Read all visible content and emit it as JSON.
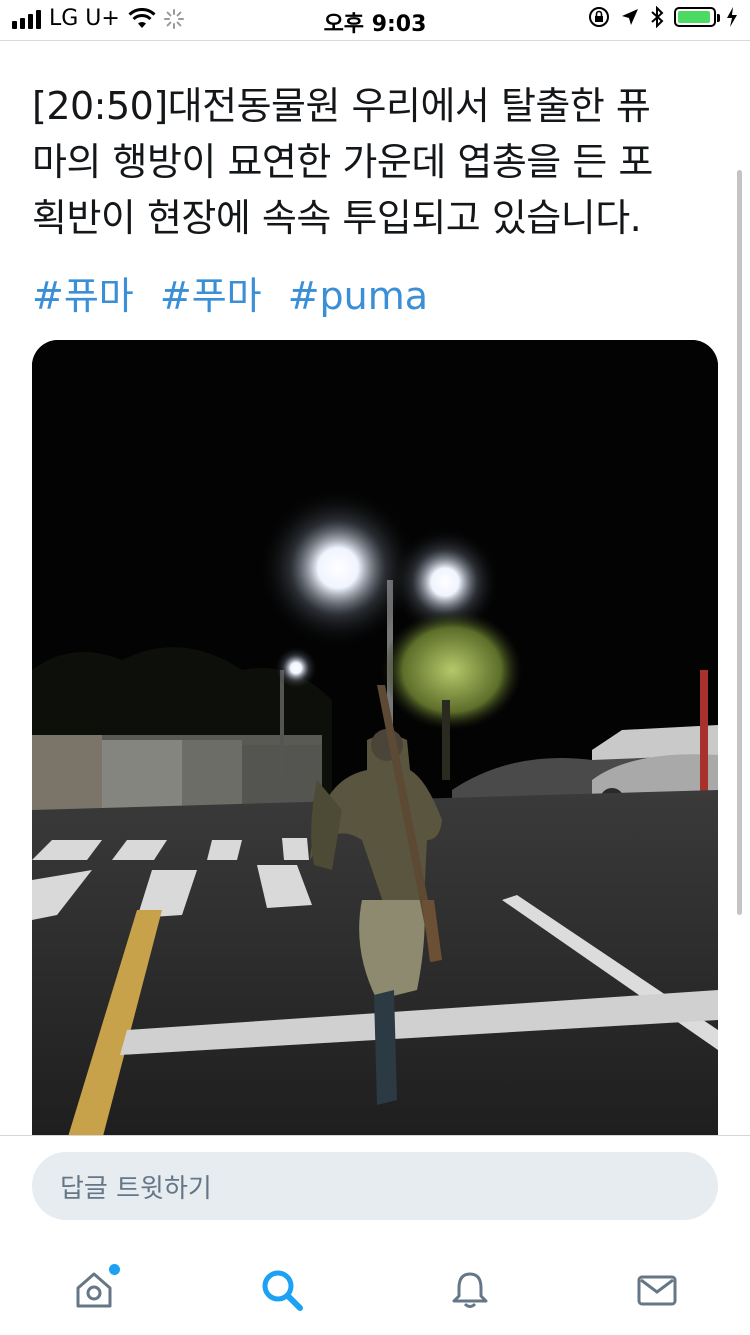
{
  "status_bar": {
    "carrier": "LG U+",
    "time": "오후 9:03",
    "battery_level": 0.95,
    "icons": [
      "signal-icon",
      "wifi-icon",
      "loading-icon",
      "rotation-lock-icon",
      "location-icon",
      "bluetooth-icon",
      "battery-icon",
      "charging-icon"
    ]
  },
  "tweet": {
    "text_lines": [
      "[20:50]대전동물원 우리에서 탈출한 퓨",
      "마의 행방이 묘연한 가운데 엽총을 든 포",
      "획반이 현장에 속속 투입되고 있습니다."
    ],
    "hashtags": [
      "#퓨마",
      "#푸마",
      "#puma"
    ],
    "link_color": "#3a8fd6"
  },
  "photo": {
    "description_icon": "photo-image"
  },
  "reply": {
    "placeholder": "답글 트윗하기"
  },
  "tab_bar": {
    "items": [
      {
        "icon": "home-icon",
        "active": false,
        "has_badge": true
      },
      {
        "icon": "search-icon",
        "active": true
      },
      {
        "icon": "bell-icon",
        "active": false
      },
      {
        "icon": "mail-icon",
        "active": false
      }
    ],
    "active_color": "#1da1f2",
    "inactive_color": "#657786"
  }
}
